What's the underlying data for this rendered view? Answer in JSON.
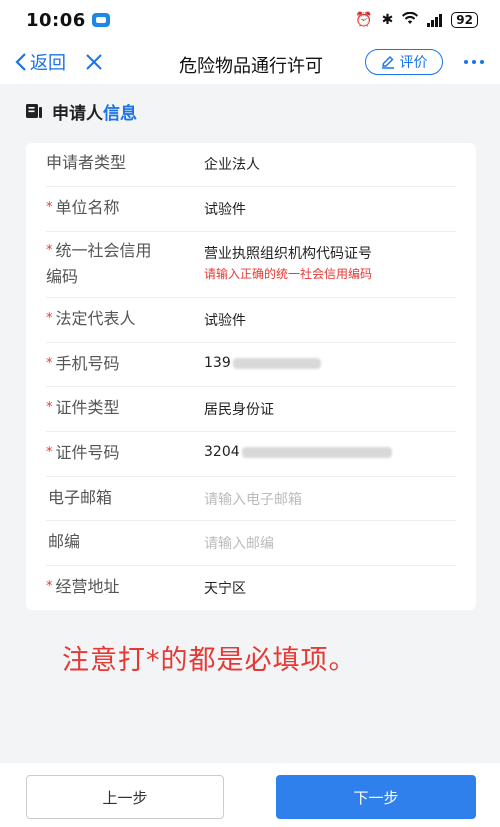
{
  "status_bar": {
    "time": "10:06",
    "battery": "92"
  },
  "nav": {
    "back_label": "返回",
    "title": "危险物品通行许可",
    "rate_label": "评价"
  },
  "section": {
    "title_main": "申请人",
    "title_accent": "信息"
  },
  "form": {
    "rows": [
      {
        "label": "申请者类型",
        "required": false,
        "value": "企业法人"
      },
      {
        "label": "单位名称",
        "required": true,
        "value": "试验件"
      },
      {
        "label_line1": "统一社会信用",
        "label_line2": "编码",
        "required": true,
        "value": "营业执照组织机构代码证号",
        "error": "请输入正确的统一社会信用编码"
      },
      {
        "label": "法定代表人",
        "required": true,
        "value": "试验件"
      },
      {
        "label": "手机号码",
        "required": true,
        "value": "139"
      },
      {
        "label": "证件类型",
        "required": true,
        "value": "居民身份证"
      },
      {
        "label": "证件号码",
        "required": true,
        "value": "3204"
      },
      {
        "label": "电子邮箱",
        "required": false,
        "placeholder": "请输入电子邮箱"
      },
      {
        "label": "邮编",
        "required": false,
        "placeholder": "请输入邮编"
      },
      {
        "label": "经营地址",
        "required": true,
        "value": "天宁区"
      }
    ],
    "required_mark": "*"
  },
  "note": "注意打*的都是必填项。",
  "buttons": {
    "prev": "上一步",
    "next": "下一步"
  },
  "colors": {
    "accent": "#1a73e8",
    "primary_button": "#2f80ed",
    "error": "#e53935"
  }
}
